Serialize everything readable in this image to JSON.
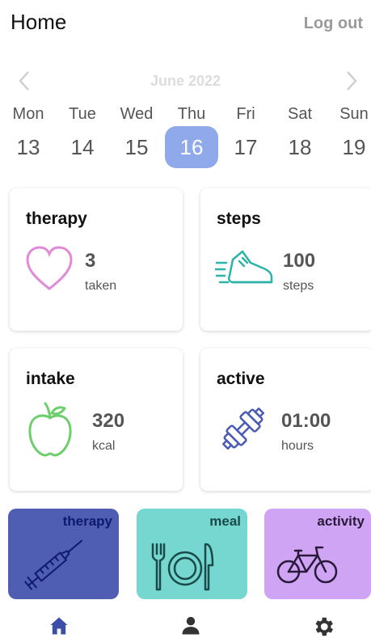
{
  "header": {
    "title": "Home",
    "logout_label": "Log out"
  },
  "calendar": {
    "month_label": "June 2022",
    "prev_icon": "chevron-left-icon",
    "next_icon": "chevron-right-icon",
    "days": [
      {
        "name": "Mon",
        "num": "13"
      },
      {
        "name": "Tue",
        "num": "14"
      },
      {
        "name": "Wed",
        "num": "15"
      },
      {
        "name": "Thu",
        "num": "16",
        "selected": true
      },
      {
        "name": "Fri",
        "num": "17"
      },
      {
        "name": "Sat",
        "num": "18"
      },
      {
        "name": "Sun",
        "num": "19"
      }
    ],
    "selected_color": "#8fa9ea"
  },
  "cards": {
    "therapy": {
      "title": "therapy",
      "value": "3",
      "unit": "taken",
      "icon": "heart-icon",
      "color": "#e08ad8"
    },
    "steps": {
      "title": "steps",
      "value": "100",
      "unit": "steps",
      "icon": "running-shoe-icon",
      "color": "#2bb3a8"
    },
    "intake": {
      "title": "intake",
      "value": "320",
      "unit": "kcal",
      "icon": "apple-icon",
      "color": "#6ccf6c"
    },
    "active": {
      "title": "active",
      "value": "01:00",
      "unit": "hours",
      "icon": "dumbbell-icon",
      "color": "#4a5bb3"
    }
  },
  "tiles": {
    "therapy": {
      "label": "therapy",
      "icon": "syringe-icon",
      "bg": "#4f5eb3",
      "fg": "#0f1a6b"
    },
    "meal": {
      "label": "meal",
      "icon": "plate-cutlery-icon",
      "bg": "#76d6d0",
      "fg": "#1a4a4a"
    },
    "activity": {
      "label": "activity",
      "icon": "bicycle-icon",
      "bg": "#cfa4f5",
      "fg": "#2a1a3a"
    }
  },
  "nav": {
    "home_icon": "home-icon",
    "profile_icon": "person-icon",
    "settings_icon": "gear-icon",
    "active_color": "#3b4fa8",
    "inactive_color": "#333333"
  }
}
